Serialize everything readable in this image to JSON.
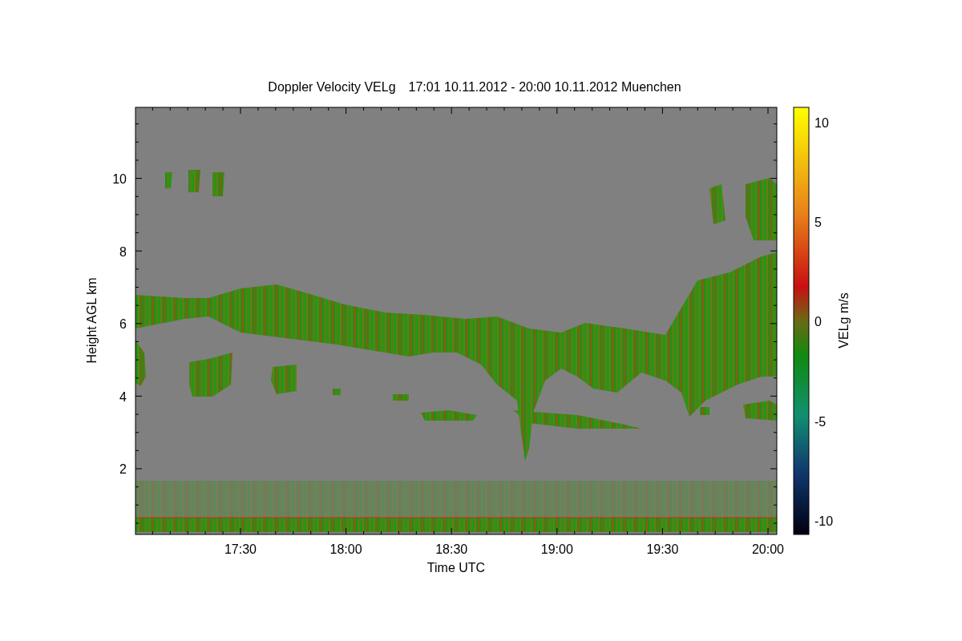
{
  "figure": {
    "title": "Doppler Velocity VELg",
    "period": "17:01 10.11.2012 - 20:00 10.11.2012 Muenchen",
    "xlabel": "Time UTC",
    "ylabel": "Height AGL km",
    "xticks": [
      "17:30",
      "18:00",
      "18:30",
      "19:00",
      "19:30",
      "20:00"
    ],
    "yticks": [
      "10",
      "8",
      "6",
      "4",
      "2"
    ]
  },
  "colorbar": {
    "label": "VELg m/s",
    "ticks": [
      "10",
      "5",
      "0",
      "-5",
      "-10"
    ]
  }
}
